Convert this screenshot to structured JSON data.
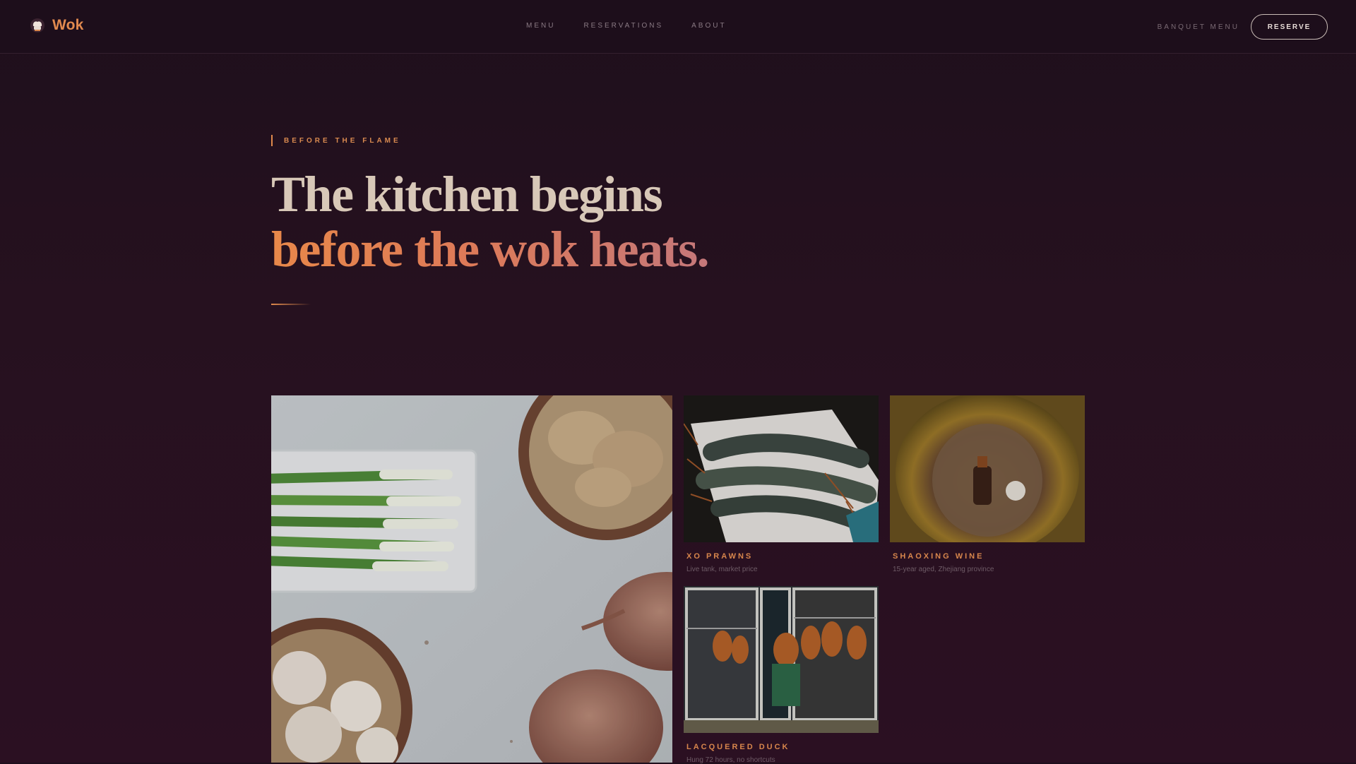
{
  "nav": {
    "brand": "Wok",
    "links": [
      "MENU",
      "RESERVATIONS",
      "ABOUT"
    ],
    "secondary": "BANQUET MENU",
    "reserve": "RESERVE"
  },
  "hero": {
    "eyebrow": "BEFORE THE FLAME",
    "line1": "The kitchen begins",
    "line2": "before the wok heats."
  },
  "gallery": {
    "cards": [
      {
        "title": "XO PRAWNS",
        "desc": "Live tank, market price"
      },
      {
        "title": "SHAOXING WINE",
        "desc": "15-year aged, Zhejiang province"
      },
      {
        "title": "LACQUERED DUCK",
        "desc": "Hung 72 hours, no shortcuts"
      }
    ]
  },
  "colors": {
    "background": "#26111f",
    "accent": "#e08a4c",
    "headline": "#d8c8b8"
  },
  "icons": [
    "chef-hat-icon"
  ]
}
